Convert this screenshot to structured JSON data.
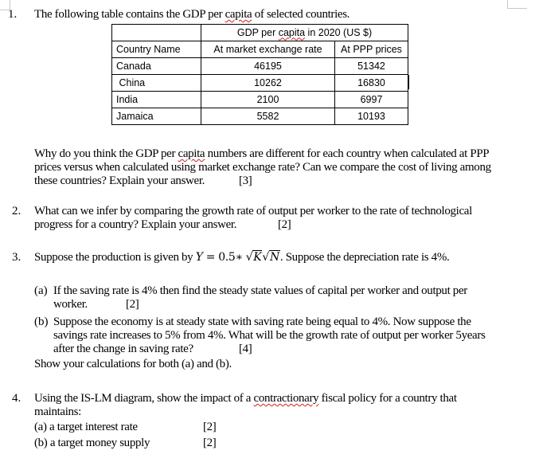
{
  "decor": {
    "corner_marks": [
      "top-left",
      "top-right"
    ]
  },
  "q1": {
    "number": "1.",
    "intro_before": "The following table contains the GDP per ",
    "intro_squiggle": "capita",
    "intro_after": " of selected countries.",
    "table": {
      "group_header_before": "GDP per ",
      "group_header_squiggle": "capita",
      "group_header_after": " in 2020 (US $)",
      "columns": [
        "Country Name",
        "At market exchange rate",
        "At PPP prices"
      ],
      "rows": [
        {
          "country": "Canada",
          "market": "46195",
          "ppp": "51342"
        },
        {
          "country": " China",
          "market": "10262",
          "ppp": "16830"
        },
        {
          "country": "India",
          "market": "2100",
          "ppp": "6997"
        },
        {
          "country": "Jamaica",
          "market": "5582",
          "ppp": "10193"
        }
      ]
    },
    "para_l1_before": "Why do you think the GDP per ",
    "para_l1_squiggle": "capita",
    "para_l1_after": " numbers are different for each country when calculated at PPP",
    "para_l2": "prices versus when calculated using market exchange rate? Can we compare the cost of living among",
    "para_l3": "these countries? Explain your answer.",
    "marks": "[3]"
  },
  "q2": {
    "number": "2.",
    "l1": "What can we infer by comparing the growth rate of output per worker to the rate of technological",
    "l2": "progress  for a country? Explain your answer.",
    "marks": "[2]"
  },
  "q3": {
    "number": "3.",
    "before": "Suppose the production is given by ",
    "formula_lhs": "Y",
    "formula_eq": " = ",
    "formula_coef": "0.5∗ ",
    "formula_k": "K",
    "formula_n": "N",
    "after": ". Suppose the depreciation rate is 4%.",
    "a_label": "(a)",
    "a_l1": "If the saving rate is 4% then find the steady state values of capital per worker and output per",
    "a_l2": "worker.",
    "a_marks": "[2]",
    "b_label": "(b)",
    "b_l1": "Suppose the economy is at steady state with saving rate being equal to 4%. Now suppose the",
    "b_l2": "savings rate increases to 5% from 4%. What will be the growth rate of output per worker 5years",
    "b_l3": "after the change in saving rate?",
    "b_marks": "[4]",
    "show": "Show your calculations for both (a) and (b)."
  },
  "q4": {
    "number": "4.",
    "l1_before": "Using the IS-LM diagram, show the impact of a ",
    "l1_squiggle": "contractionary",
    "l1_after": " fiscal policy for a country that",
    "l2": "maintains:",
    "a": "(a) a target interest rate",
    "a_marks": "[2]",
    "b": "(b) a target money supply",
    "b_marks": "[2]"
  }
}
